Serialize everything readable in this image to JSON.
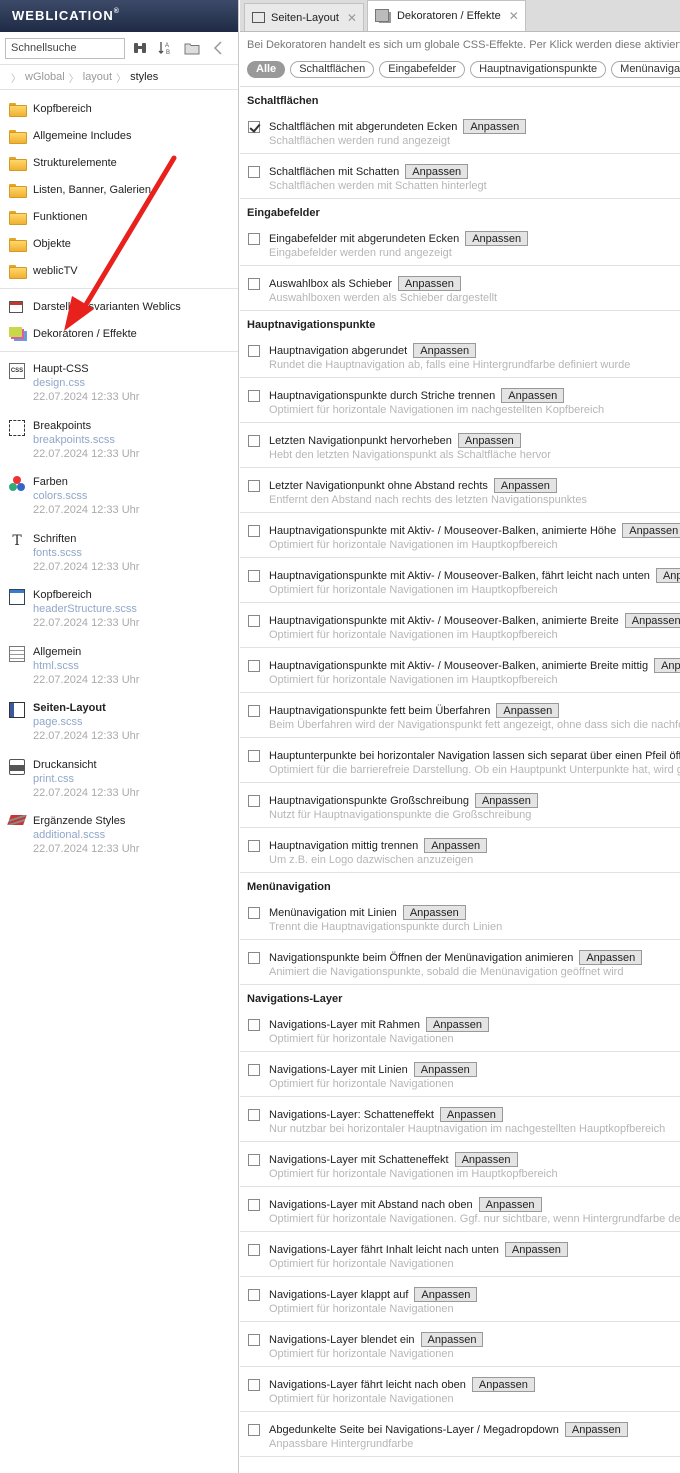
{
  "brand": {
    "name": "WEBLICATION",
    "mark": "®"
  },
  "search": {
    "placeholder": "Schnellsuche"
  },
  "breadcrumb": [
    "wGlobal",
    "layout",
    "styles"
  ],
  "folders": [
    "Kopfbereich",
    "Allgemeine Includes",
    "Strukturelemente",
    "Listen, Banner, Galerien",
    "Funktionen",
    "Objekte",
    "weblicTV"
  ],
  "special": [
    {
      "label": "Darstellungsvarianten Weblics",
      "icon": "layout-icon"
    },
    {
      "label": "Dekoratoren / Effekte",
      "icon": "decorator-icon"
    }
  ],
  "styles": [
    {
      "name": "Haupt-CSS",
      "file": "design.css",
      "date": "22.07.2024 12:33 Uhr",
      "icon": "css-file-icon",
      "bold": false
    },
    {
      "name": "Breakpoints",
      "file": "breakpoints.scss",
      "date": "22.07.2024 12:33 Uhr",
      "icon": "breakpoints-icon",
      "bold": false
    },
    {
      "name": "Farben",
      "file": "colors.scss",
      "date": "22.07.2024 12:33 Uhr",
      "icon": "colors-icon",
      "bold": false
    },
    {
      "name": "Schriften",
      "file": "fonts.scss",
      "date": "22.07.2024 12:33 Uhr",
      "icon": "fonts-icon",
      "bold": false
    },
    {
      "name": "Kopfbereich",
      "file": "headerStructure.scss",
      "date": "22.07.2024 12:33 Uhr",
      "icon": "header-icon",
      "bold": false
    },
    {
      "name": "Allgemein",
      "file": "html.scss",
      "date": "22.07.2024 12:33 Uhr",
      "icon": "general-icon",
      "bold": false
    },
    {
      "name": "Seiten-Layout",
      "file": "page.scss",
      "date": "22.07.2024 12:33 Uhr",
      "icon": "page-layout-icon",
      "bold": true
    },
    {
      "name": "Druckansicht",
      "file": "print.css",
      "date": "22.07.2024 12:33 Uhr",
      "icon": "print-icon",
      "bold": false
    },
    {
      "name": "Ergänzende Styles",
      "file": "additional.scss",
      "date": "22.07.2024 12:33 Uhr",
      "icon": "additional-styles-icon",
      "bold": false
    }
  ],
  "tabs": [
    {
      "label": "Seiten-Layout",
      "active": false
    },
    {
      "label": "Dekoratoren / Effekte",
      "active": true
    }
  ],
  "description": "Bei Dekoratoren handelt es sich um globale CSS-Effekte. Per Klick werden diese aktiviert.",
  "filters": [
    "Alle",
    "Schaltflächen",
    "Eingabefelder",
    "Hauptnavigationspunkte",
    "Menünavigation"
  ],
  "button_label": "Anpassen",
  "groups": [
    {
      "title": "Schaltflächen",
      "options": [
        {
          "label": "Schaltflächen mit abgerundeten Ecken",
          "sub": "Schaltflächen werden rund angezeigt",
          "checked": true
        },
        {
          "label": "Schaltflächen mit Schatten",
          "sub": "Schaltflächen werden mit Schatten hinterlegt",
          "checked": false
        }
      ]
    },
    {
      "title": "Eingabefelder",
      "options": [
        {
          "label": "Eingabefelder mit abgerundeten Ecken",
          "sub": "Eingabefelder werden rund angezeigt",
          "checked": false
        },
        {
          "label": "Auswahlbox als Schieber",
          "sub": "Auswahlboxen werden als Schieber dargestellt",
          "checked": false
        }
      ]
    },
    {
      "title": "Hauptnavigationspunkte",
      "options": [
        {
          "label": "Hauptnavigation abgerundet",
          "sub": "Rundet die Hauptnavigation ab, falls eine Hintergrundfarbe definiert wurde",
          "checked": false
        },
        {
          "label": "Hauptnavigationspunkte durch Striche trennen",
          "sub": "Optimiert für horizontale Navigationen im nachgestellten Kopfbereich",
          "checked": false
        },
        {
          "label": "Letzten Navigationpunkt hervorheben",
          "sub": "Hebt den letzten Navigationspunkt als Schaltfläche hervor",
          "checked": false
        },
        {
          "label": "Letzter Navigationpunkt ohne Abstand rechts",
          "sub": "Entfernt den Abstand nach rechts des letzten Navigationspunktes",
          "checked": false
        },
        {
          "label": "Hauptnavigationspunkte mit Aktiv- / Mouseover-Balken, animierte Höhe",
          "sub": "Optimiert für horizontale Navigationen im Hauptkopfbereich",
          "checked": false
        },
        {
          "label": "Hauptnavigationspunkte mit Aktiv- / Mouseover-Balken, fährt leicht nach unten",
          "sub": "Optimiert für horizontale Navigationen im Hauptkopfbereich",
          "checked": false
        },
        {
          "label": "Hauptnavigationspunkte mit Aktiv- / Mouseover-Balken, animierte Breite",
          "sub": "Optimiert für horizontale Navigationen im Hauptkopfbereich",
          "checked": false
        },
        {
          "label": "Hauptnavigationspunkte mit Aktiv- / Mouseover-Balken, animierte Breite mittig",
          "sub": "Optimiert für horizontale Navigationen im Hauptkopfbereich",
          "checked": false
        },
        {
          "label": "Hauptnavigationspunkte fett beim Überfahren",
          "sub": "Beim Überfahren wird der Navigationspunkt fett angezeigt, ohne dass sich die nachfolgenden verschieben",
          "checked": false
        },
        {
          "label": "Hauptunterpunkte bei horizontaler Navigation lassen sich separat über einen Pfeil öffnen",
          "sub": "Optimiert für die barrierefreie Darstellung. Ob ein Hauptpunkt Unterpunkte hat, wird gekennzeichnet",
          "checked": false
        },
        {
          "label": "Hauptnavigationspunkte Großschreibung",
          "sub": "Nutzt für Hauptnavigationspunkte die Großschreibung",
          "checked": false
        },
        {
          "label": "Hauptnavigation mittig trennen",
          "sub": "Um z.B. ein Logo dazwischen anzuzeigen",
          "checked": false
        }
      ]
    },
    {
      "title": "Menünavigation",
      "options": [
        {
          "label": "Menünavigation mit Linien",
          "sub": "Trennt die Hauptnavigationspunkte durch Linien",
          "checked": false
        },
        {
          "label": "Navigationspunkte beim Öffnen der Menünavigation animieren",
          "sub": "Animiert die Navigationspunkte, sobald die Menünavigation geöffnet wird",
          "checked": false
        }
      ]
    },
    {
      "title": "Navigations-Layer",
      "options": [
        {
          "label": "Navigations-Layer mit Rahmen",
          "sub": "Optimiert für horizontale Navigationen",
          "checked": false
        },
        {
          "label": "Navigations-Layer mit Linien",
          "sub": "Optimiert für horizontale Navigationen",
          "checked": false
        },
        {
          "label": "Navigations-Layer: Schatteneffekt",
          "sub": "Nur nutzbar bei horizontaler Hauptnavigation im nachgestellten Hauptkopfbereich",
          "checked": false
        },
        {
          "label": "Navigations-Layer mit Schatteneffekt",
          "sub": "Optimiert für horizontale Navigationen im Hauptkopfbereich",
          "checked": false
        },
        {
          "label": "Navigations-Layer mit Abstand nach oben",
          "sub": "Optimiert für horizontale Navigationen. Ggf. nur sichtbare, wenn Hintergrundfarbe definiert",
          "checked": false
        },
        {
          "label": "Navigations-Layer fährt Inhalt leicht nach unten",
          "sub": "Optimiert für horizontale Navigationen",
          "checked": false
        },
        {
          "label": "Navigations-Layer klappt auf",
          "sub": "Optimiert für horizontale Navigationen",
          "checked": false
        },
        {
          "label": "Navigations-Layer blendet ein",
          "sub": "Optimiert für horizontale Navigationen",
          "checked": false
        },
        {
          "label": "Navigations-Layer fährt leicht nach oben",
          "sub": "Optimiert für horizontale Navigationen",
          "checked": false
        },
        {
          "label": "Abgedunkelte Seite bei Navigations-Layer / Megadropdown",
          "sub": "Anpassbare Hintergrundfarbe",
          "checked": false
        }
      ]
    }
  ],
  "colors": {
    "accent_arrow": "#e8211c",
    "brand_bg": "#2a3552",
    "filter_active": "#999999"
  }
}
